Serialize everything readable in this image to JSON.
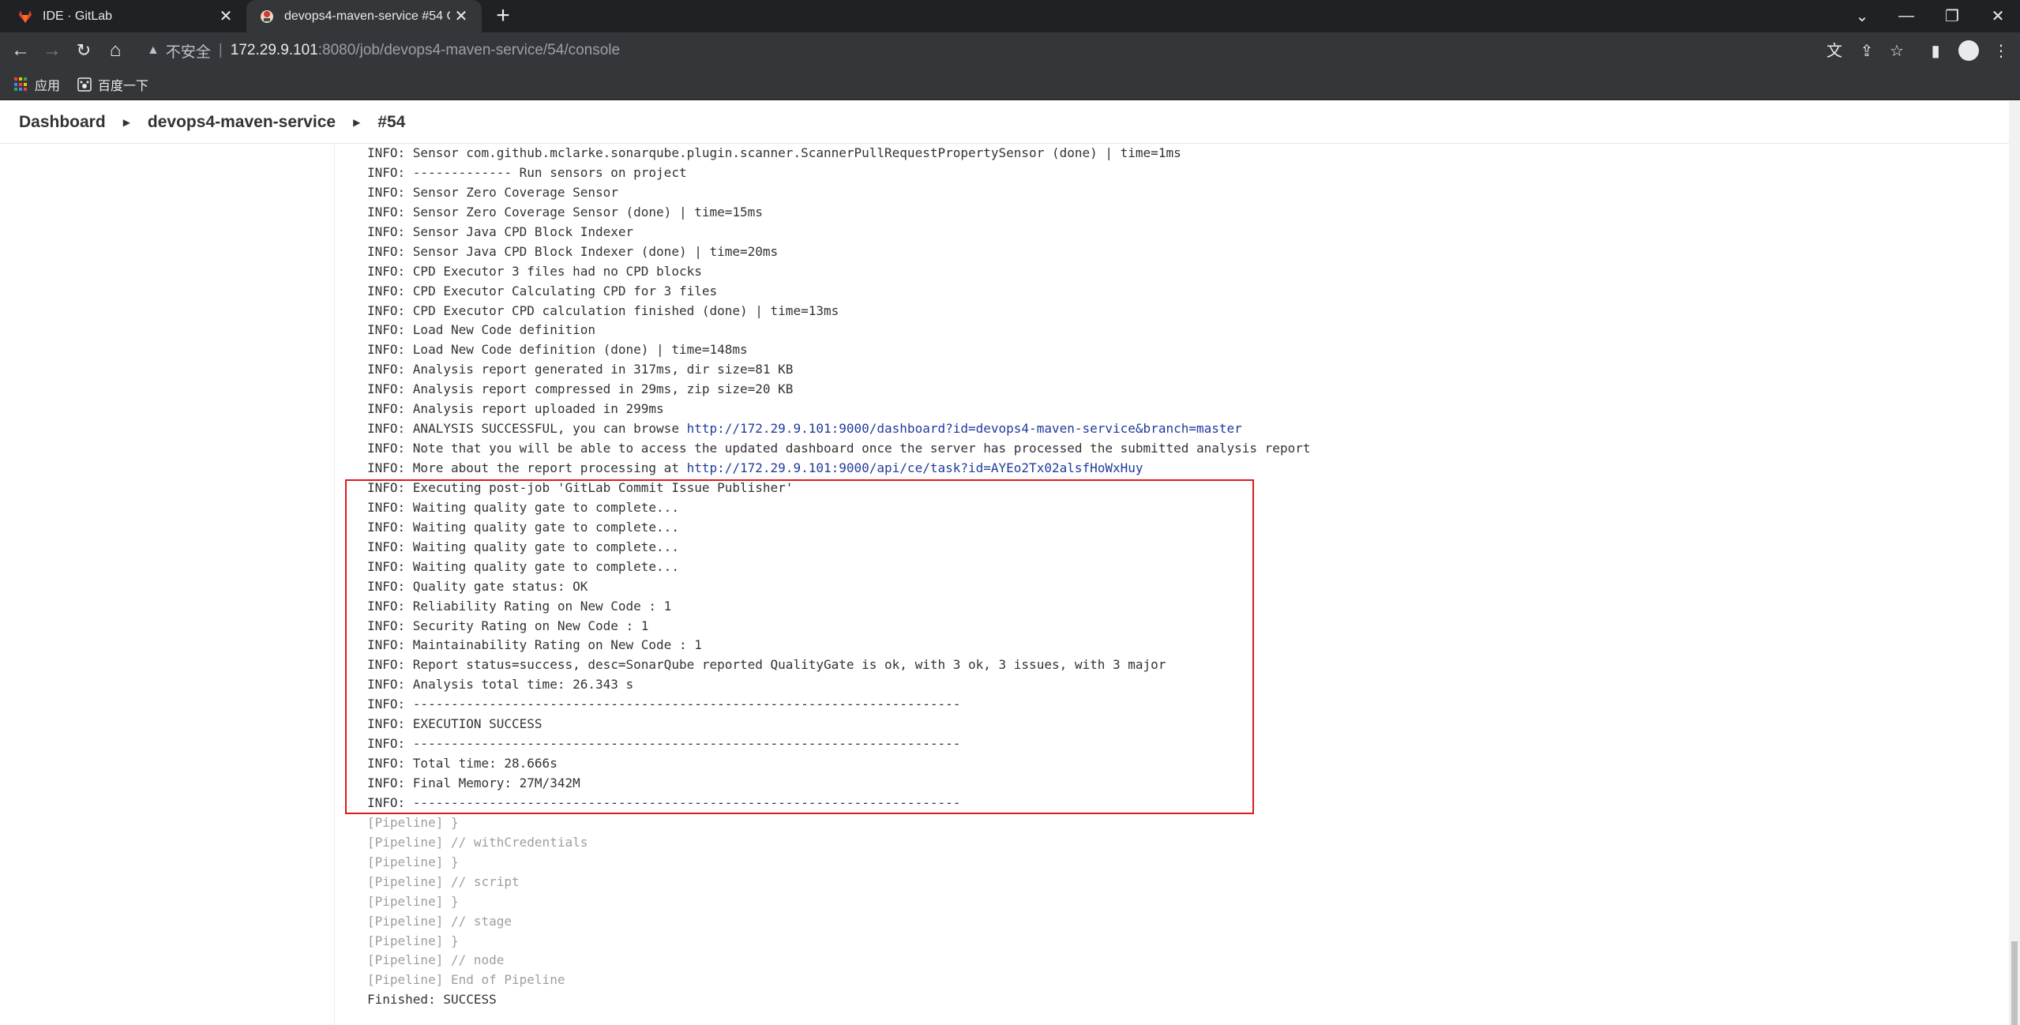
{
  "browser": {
    "tabs": [
      {
        "title": "IDE · GitLab",
        "icon": "gitlab-logo-icon"
      },
      {
        "title": "devops4-maven-service #54 C",
        "icon": "jenkins-logo-icon"
      }
    ],
    "address": {
      "security_label": "不安全",
      "host": "172.29.9.101",
      "path": ":8080/job/devops4-maven-service/54/console"
    },
    "bookmarks": [
      {
        "label": "应用"
      },
      {
        "label": "百度一下"
      }
    ]
  },
  "breadcrumb": {
    "items": [
      "Dashboard",
      "devops4-maven-service",
      "#54"
    ]
  },
  "console": {
    "lines": [
      {
        "text": "INFO: Sensor com.github.mclarke.sonarqube.plugin.scanner.ScannerPullRequestPropertySensor (done) | time=1ms"
      },
      {
        "text": "INFO: ------------- Run sensors on project"
      },
      {
        "text": "INFO: Sensor Zero Coverage Sensor"
      },
      {
        "text": "INFO: Sensor Zero Coverage Sensor (done) | time=15ms"
      },
      {
        "text": "INFO: Sensor Java CPD Block Indexer"
      },
      {
        "text": "INFO: Sensor Java CPD Block Indexer (done) | time=20ms"
      },
      {
        "text": "INFO: CPD Executor 3 files had no CPD blocks"
      },
      {
        "text": "INFO: CPD Executor Calculating CPD for 3 files"
      },
      {
        "text": "INFO: CPD Executor CPD calculation finished (done) | time=13ms"
      },
      {
        "text": "INFO: Load New Code definition"
      },
      {
        "text": "INFO: Load New Code definition (done) | time=148ms"
      },
      {
        "text": "INFO: Analysis report generated in 317ms, dir size=81 KB"
      },
      {
        "text": "INFO: Analysis report compressed in 29ms, zip size=20 KB"
      },
      {
        "text": "INFO: Analysis report uploaded in 299ms"
      },
      {
        "text": "INFO: ANALYSIS SUCCESSFUL, you can browse ",
        "link": "http://172.29.9.101:9000/dashboard?id=devops4-maven-service&branch=master"
      },
      {
        "text": "INFO: Note that you will be able to access the updated dashboard once the server has processed the submitted analysis report"
      },
      {
        "text": "INFO: More about the report processing at ",
        "link": "http://172.29.9.101:9000/api/ce/task?id=AYEo2Tx02alsfHoWxHuy"
      },
      {
        "text": "INFO: Executing post-job 'GitLab Commit Issue Publisher'"
      },
      {
        "text": "INFO: Waiting quality gate to complete..."
      },
      {
        "text": "INFO: Waiting quality gate to complete..."
      },
      {
        "text": "INFO: Waiting quality gate to complete..."
      },
      {
        "text": "INFO: Waiting quality gate to complete..."
      },
      {
        "text": "INFO: Quality gate status: OK"
      },
      {
        "text": "INFO: Reliability Rating on New Code : 1"
      },
      {
        "text": "INFO: Security Rating on New Code : 1"
      },
      {
        "text": "INFO: Maintainability Rating on New Code : 1"
      },
      {
        "text": "INFO: Report status=success, desc=SonarQube reported QualityGate is ok, with 3 ok, 3 issues, with 3 major"
      },
      {
        "text": "INFO: Analysis total time: 26.343 s"
      },
      {
        "text": "INFO: ------------------------------------------------------------------------"
      },
      {
        "text": "INFO: EXECUTION SUCCESS"
      },
      {
        "text": "INFO: ------------------------------------------------------------------------"
      },
      {
        "text": "INFO: Total time: 28.666s"
      },
      {
        "text": "INFO: Final Memory: 27M/342M"
      },
      {
        "text": "INFO: ------------------------------------------------------------------------"
      },
      {
        "text": "[Pipeline] }",
        "muted": true
      },
      {
        "text": "[Pipeline] // withCredentials",
        "muted": true
      },
      {
        "text": "[Pipeline] }",
        "muted": true
      },
      {
        "text": "[Pipeline] // script",
        "muted": true
      },
      {
        "text": "[Pipeline] }",
        "muted": true
      },
      {
        "text": "[Pipeline] // stage",
        "muted": true
      },
      {
        "text": "[Pipeline] }",
        "muted": true
      },
      {
        "text": "[Pipeline] // node",
        "muted": true
      },
      {
        "text": "[Pipeline] End of Pipeline",
        "muted": true
      },
      {
        "text": "Finished: SUCCESS"
      }
    ]
  },
  "colors": {
    "highlight_border": "#e0191f",
    "link": "#1f3b9c",
    "muted_text": "#9e9e9e"
  }
}
